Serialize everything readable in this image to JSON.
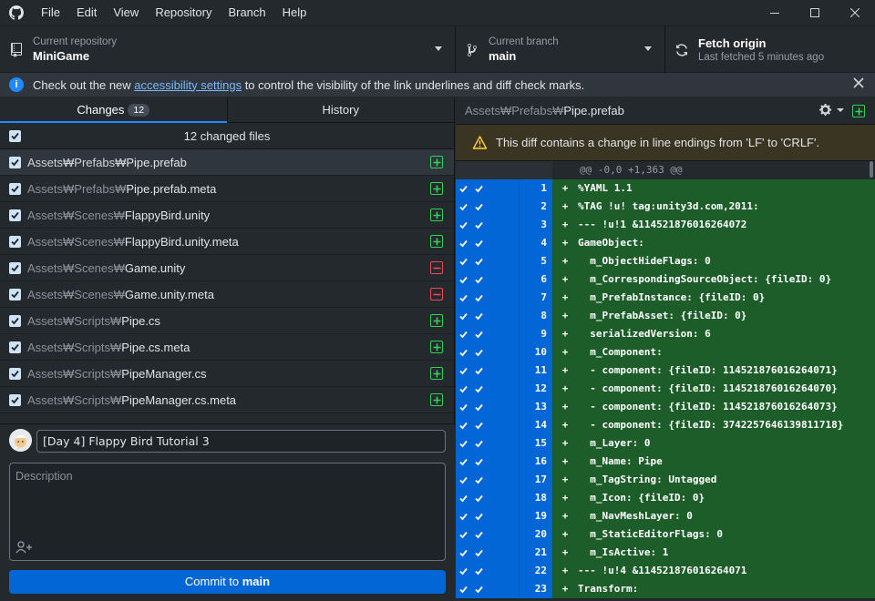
{
  "menu": [
    "File",
    "Edit",
    "View",
    "Repository",
    "Branch",
    "Help"
  ],
  "toolbar": {
    "repo_label": "Current repository",
    "repo_value": "MiniGame",
    "branch_label": "Current branch",
    "branch_value": "main",
    "fetch_label": "Fetch origin",
    "fetch_sub": "Last fetched 5 minutes ago"
  },
  "banner": {
    "text_before": "Check out the new ",
    "link": "accessibility settings",
    "text_after": " to control the visibility of the link underlines and diff check marks."
  },
  "tabs": {
    "changes_label": "Changes",
    "changes_count": "12",
    "history_label": "History"
  },
  "files_header": "12 changed files",
  "files": [
    {
      "dir": "Assets₩Prefabs₩",
      "name": "Pipe.prefab",
      "status": "added",
      "selected": true
    },
    {
      "dir": "Assets₩Prefabs₩",
      "name": "Pipe.prefab.meta",
      "status": "added"
    },
    {
      "dir": "Assets₩Scenes₩",
      "name": "FlappyBird.unity",
      "status": "added"
    },
    {
      "dir": "Assets₩Scenes₩",
      "name": "FlappyBird.unity.meta",
      "status": "added"
    },
    {
      "dir": "Assets₩Scenes₩",
      "name": "Game.unity",
      "status": "deleted"
    },
    {
      "dir": "Assets₩Scenes₩",
      "name": "Game.unity.meta",
      "status": "deleted"
    },
    {
      "dir": "Assets₩Scripts₩",
      "name": "Pipe.cs",
      "status": "added"
    },
    {
      "dir": "Assets₩Scripts₩",
      "name": "Pipe.cs.meta",
      "status": "added"
    },
    {
      "dir": "Assets₩Scripts₩",
      "name": "PipeManager.cs",
      "status": "added"
    },
    {
      "dir": "Assets₩Scripts₩",
      "name": "PipeManager.cs.meta",
      "status": "added"
    }
  ],
  "commit": {
    "summary": "[Day 4] Flappy Bird Tutorial 3",
    "description_placeholder": "Description",
    "button_prefix": "Commit to ",
    "button_branch": "main"
  },
  "diff": {
    "path_dir": "Assets₩Prefabs₩",
    "path_file": "Pipe.prefab",
    "warning": "This diff contains a change in line endings from 'LF' to 'CRLF'.",
    "hunk": "@@ -0,0 +1,363 @@",
    "lines": [
      {
        "n": "1",
        "t": "%YAML 1.1"
      },
      {
        "n": "2",
        "t": "%TAG !u! tag:unity3d.com,2011:"
      },
      {
        "n": "3",
        "t": "--- !u!1 &114521876016264072"
      },
      {
        "n": "4",
        "t": "GameObject:"
      },
      {
        "n": "5",
        "t": "  m_ObjectHideFlags: 0"
      },
      {
        "n": "6",
        "t": "  m_CorrespondingSourceObject: {fileID: 0}"
      },
      {
        "n": "7",
        "t": "  m_PrefabInstance: {fileID: 0}"
      },
      {
        "n": "8",
        "t": "  m_PrefabAsset: {fileID: 0}"
      },
      {
        "n": "9",
        "t": "  serializedVersion: 6"
      },
      {
        "n": "10",
        "t": "  m_Component:"
      },
      {
        "n": "11",
        "t": "  - component: {fileID: 114521876016264071}"
      },
      {
        "n": "12",
        "t": "  - component: {fileID: 114521876016264070}"
      },
      {
        "n": "13",
        "t": "  - component: {fileID: 114521876016264073}"
      },
      {
        "n": "14",
        "t": "  - component: {fileID: 3742257646139811718}"
      },
      {
        "n": "15",
        "t": "  m_Layer: 0"
      },
      {
        "n": "16",
        "t": "  m_Name: Pipe"
      },
      {
        "n": "17",
        "t": "  m_TagString: Untagged"
      },
      {
        "n": "18",
        "t": "  m_Icon: {fileID: 0}"
      },
      {
        "n": "19",
        "t": "  m_NavMeshLayer: 0"
      },
      {
        "n": "20",
        "t": "  m_StaticEditorFlags: 0"
      },
      {
        "n": "21",
        "t": "  m_IsActive: 1"
      },
      {
        "n": "22",
        "t": "--- !u!4 &114521876016264071"
      },
      {
        "n": "23",
        "t": "Transform:"
      }
    ]
  },
  "colors": {
    "accent": "#0366d6",
    "added": "#34d058",
    "deleted": "#ea4a5a",
    "diff_added_bg": "#1c5d2a"
  }
}
